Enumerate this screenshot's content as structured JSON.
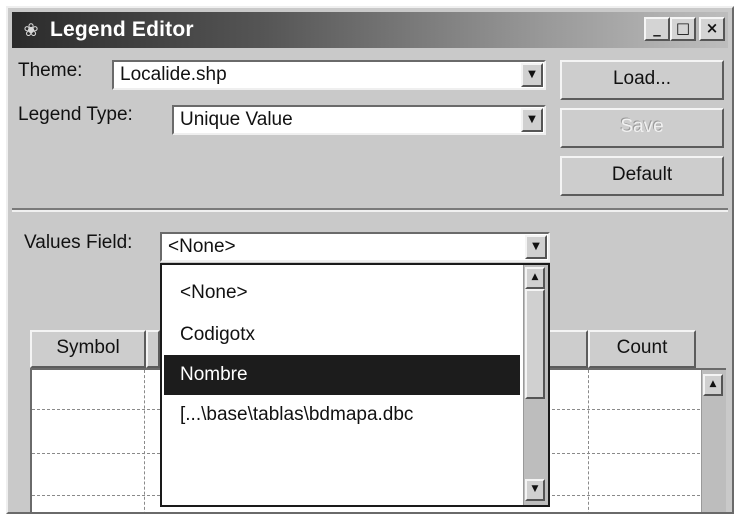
{
  "window": {
    "title": "Legend Editor",
    "controls": {
      "minimize": "_",
      "maximize": "□",
      "close": "×"
    }
  },
  "theme": {
    "label": "Theme:",
    "value": "Localide.shp"
  },
  "legend_type": {
    "label": "Legend Type:",
    "value": "Unique Value"
  },
  "buttons": {
    "load": "Load...",
    "save": "Save",
    "default": "Default"
  },
  "values_field": {
    "label": "Values Field:",
    "value": "<None>",
    "options": [
      "<None>",
      "Codigotx",
      "Nombre",
      "[...\\base\\tablas\\bdmapa.dbc"
    ],
    "selected_option": "Nombre"
  },
  "table": {
    "columns": {
      "symbol": "Symbol",
      "count": "Count"
    }
  },
  "icons": {
    "title": "app-icon",
    "dropdown": "chevron-down-icon",
    "scroll_up": "arrow-up-icon",
    "scroll_down": "arrow-down-icon"
  }
}
